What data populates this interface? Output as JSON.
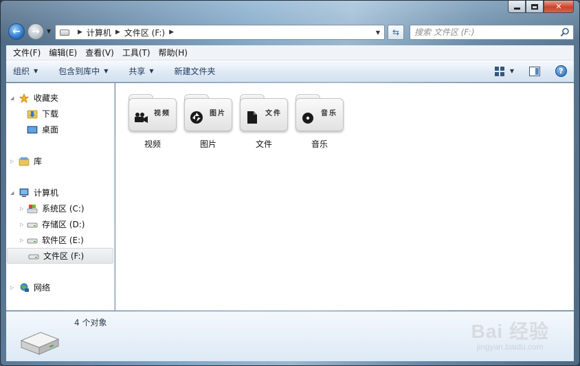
{
  "window": {
    "caption_buttons": [
      "minimize",
      "maximize",
      "close"
    ]
  },
  "nav": {
    "back_icon": "back-arrow-icon",
    "forward_icon": "forward-arrow-icon",
    "breadcrumb": [
      "计算机",
      "文件区 (F:)"
    ],
    "refresh_icon": "refresh-icon",
    "search_placeholder": "搜索 文件区 (F:)"
  },
  "menu": [
    "文件(F)",
    "编辑(E)",
    "查看(V)",
    "工具(T)",
    "帮助(H)"
  ],
  "toolbar": {
    "organize": "组织",
    "include_in_library": "包含到库中",
    "share": "共享",
    "new_folder": "新建文件夹"
  },
  "sidebar": {
    "favorites": "收藏夹",
    "favorite_items": [
      "下载",
      "桌面"
    ],
    "libraries": "库",
    "computer": "计算机",
    "drives": [
      "系统区 (C:)",
      "存储区 (D:)",
      "软件区 (E:)",
      "文件区 (F:)"
    ],
    "selected_drive": "文件区 (F:)",
    "network": "网络"
  },
  "folders": [
    {
      "label": "视频",
      "caption": "视频",
      "icon": "video-camera-icon"
    },
    {
      "label": "图片",
      "caption": "图片",
      "icon": "aperture-icon"
    },
    {
      "label": "文件",
      "caption": "文件",
      "icon": "document-icon"
    },
    {
      "label": "音乐",
      "caption": "音乐",
      "icon": "disc-icon"
    }
  ],
  "details": {
    "count": "4 个对象"
  },
  "watermark": {
    "logo": "Bai  经验",
    "url": "jingyan.baidu.com"
  },
  "colors": {
    "command_bar_text": "#1e395b",
    "close_button": "#c8452f",
    "selection_bg": "#e3e5e7"
  }
}
